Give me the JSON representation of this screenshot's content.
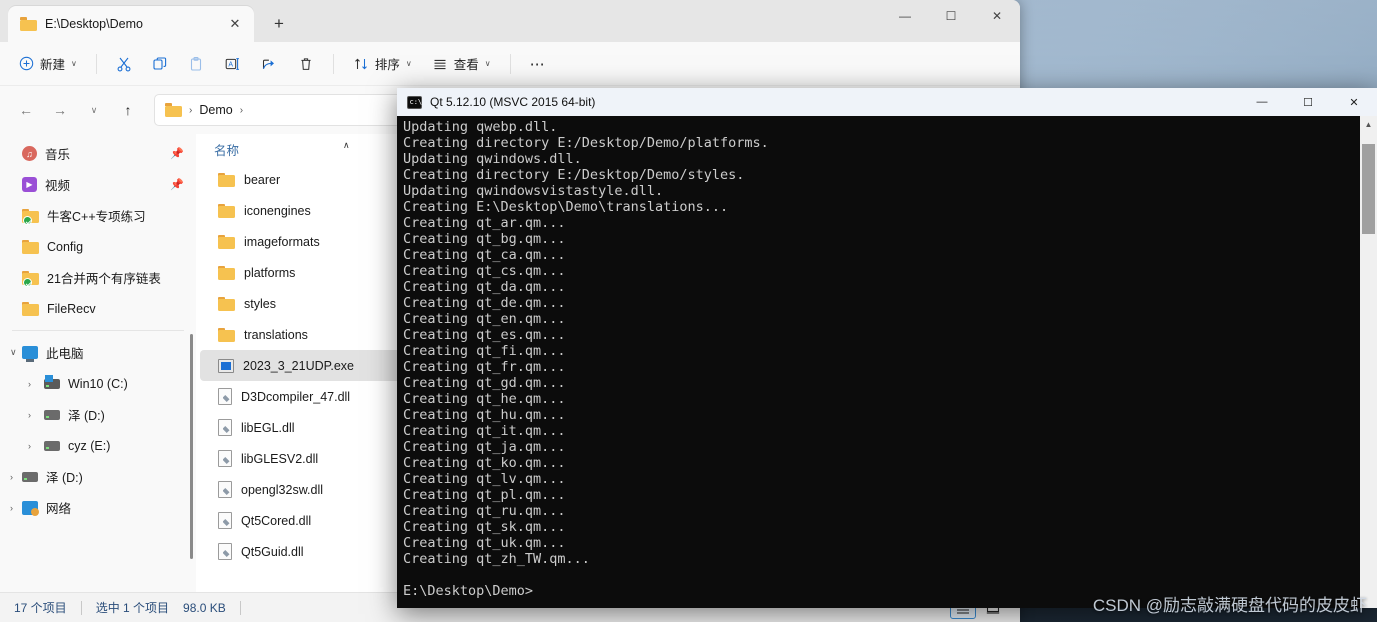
{
  "explorer": {
    "tab": {
      "title": "E:\\Desktop\\Demo",
      "close_label": "✕",
      "new_tab_label": "+",
      "folder_icon": "folder-icon"
    },
    "window_controls": {
      "minimize": "—",
      "maximize": "☐",
      "close": "✕"
    },
    "toolbar": {
      "new_label": "新建",
      "new_icon": "plus-circle-icon",
      "cut_icon": "scissors-icon",
      "copy_icon": "copy-icon",
      "paste_icon": "paste-icon",
      "rename_icon": "rename-icon",
      "share_icon": "share-icon",
      "delete_icon": "trash-icon",
      "sort_label": "排序",
      "sort_icon": "sort-arrows-icon",
      "view_label": "查看",
      "view_icon": "list-lines-icon",
      "more_label": "⋯",
      "chevron": "∨"
    },
    "nav": {
      "back": "←",
      "forward": "→",
      "recent": "∨",
      "up": "↑",
      "breadcrumb": [
        "Demo"
      ],
      "crumb_sep": "›"
    },
    "sidebar": {
      "quick_items": [
        {
          "label": "音乐",
          "icon": "music-icon",
          "pinned": true
        },
        {
          "label": "视频",
          "icon": "video-icon",
          "pinned": true
        },
        {
          "label": "牛客C++专项练习",
          "icon": "folder-sync-icon",
          "pinned": false
        },
        {
          "label": "Config",
          "icon": "folder-icon",
          "pinned": false
        },
        {
          "label": "21合并两个有序链表",
          "icon": "folder-sync-icon",
          "pinned": false
        },
        {
          "label": "FileRecv",
          "icon": "folder-icon",
          "pinned": false
        }
      ],
      "tree_items": [
        {
          "label": "此电脑",
          "icon": "this-pc-icon",
          "level": 0,
          "twisty": "∨"
        },
        {
          "label": "Win10 (C:)",
          "icon": "drive-windows-icon",
          "level": 1,
          "twisty": "›"
        },
        {
          "label": "泽 (D:)",
          "icon": "drive-icon",
          "level": 1,
          "twisty": "›"
        },
        {
          "label": "cyz (E:)",
          "icon": "drive-icon",
          "level": 1,
          "twisty": "›"
        },
        {
          "label": "泽 (D:)",
          "icon": "drive-icon",
          "level": 0,
          "twisty": "›"
        },
        {
          "label": "网络",
          "icon": "network-icon",
          "level": 0,
          "twisty": "›"
        }
      ]
    },
    "filelist": {
      "column_header": "名称",
      "sort_caret": "∧",
      "rows": [
        {
          "name": "bearer",
          "type": "folder",
          "selected": false
        },
        {
          "name": "iconengines",
          "type": "folder",
          "selected": false
        },
        {
          "name": "imageformats",
          "type": "folder",
          "selected": false
        },
        {
          "name": "platforms",
          "type": "folder",
          "selected": false
        },
        {
          "name": "styles",
          "type": "folder",
          "selected": false
        },
        {
          "name": "translations",
          "type": "folder",
          "selected": false
        },
        {
          "name": "2023_3_21UDP.exe",
          "type": "exe",
          "selected": true
        },
        {
          "name": "D3Dcompiler_47.dll",
          "type": "file",
          "selected": false
        },
        {
          "name": "libEGL.dll",
          "type": "file",
          "selected": false
        },
        {
          "name": "libGLESV2.dll",
          "type": "file",
          "selected": false
        },
        {
          "name": "opengl32sw.dll",
          "type": "file",
          "selected": false
        },
        {
          "name": "Qt5Cored.dll",
          "type": "file",
          "selected": false
        },
        {
          "name": "Qt5Guid.dll",
          "type": "file",
          "selected": false
        }
      ]
    },
    "status": {
      "item_count": "17 个项目",
      "selection": "选中 1 个项目",
      "size": "98.0 KB",
      "view_details_icon": "details-view-icon",
      "view_tiles_icon": "large-icons-view-icon"
    }
  },
  "console": {
    "title": "Qt 5.12.10 (MSVC 2015 64-bit)",
    "icon": "console-icon",
    "window_controls": {
      "minimize": "—",
      "maximize": "☐",
      "close": "✕"
    },
    "lines": [
      "Updating qwebp.dll.",
      "Creating directory E:/Desktop/Demo/platforms.",
      "Updating qwindows.dll.",
      "Creating directory E:/Desktop/Demo/styles.",
      "Updating qwindowsvistastyle.dll.",
      "Creating E:\\Desktop\\Demo\\translations...",
      "Creating qt_ar.qm...",
      "Creating qt_bg.qm...",
      "Creating qt_ca.qm...",
      "Creating qt_cs.qm...",
      "Creating qt_da.qm...",
      "Creating qt_de.qm...",
      "Creating qt_en.qm...",
      "Creating qt_es.qm...",
      "Creating qt_fi.qm...",
      "Creating qt_fr.qm...",
      "Creating qt_gd.qm...",
      "Creating qt_he.qm...",
      "Creating qt_hu.qm...",
      "Creating qt_it.qm...",
      "Creating qt_ja.qm...",
      "Creating qt_ko.qm...",
      "Creating qt_lv.qm...",
      "Creating qt_pl.qm...",
      "Creating qt_ru.qm...",
      "Creating qt_sk.qm...",
      "Creating qt_uk.qm...",
      "Creating qt_zh_TW.qm...",
      "",
      "E:\\Desktop\\Demo>"
    ]
  },
  "watermark": "CSDN @励志敲满硬盘代码的皮皮虾"
}
